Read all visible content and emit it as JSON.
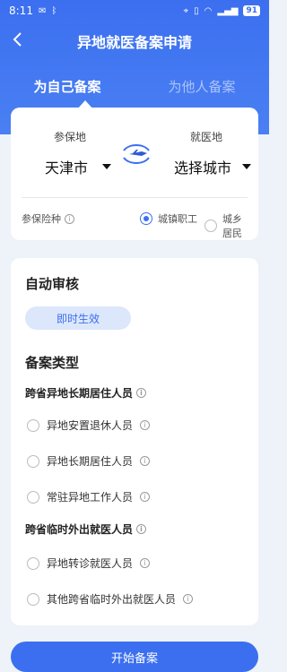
{
  "status": {
    "time": "8:11",
    "battery": "91"
  },
  "header": {
    "title": "异地就医备案申请"
  },
  "tabs": [
    {
      "label": "为自己备案",
      "active": true
    },
    {
      "label": "为他人备案",
      "active": false
    }
  ],
  "location": {
    "insured_label": "参保地",
    "insured_value": "天津市",
    "medical_label": "就医地",
    "medical_value": "选择城市"
  },
  "insurance": {
    "label": "参保险种",
    "options": [
      {
        "label": "城镇职工",
        "selected": true
      },
      {
        "label": "城乡居民",
        "selected": false
      }
    ]
  },
  "audit": {
    "title": "自动审核",
    "badge": "即时生效"
  },
  "filing": {
    "title": "备案类型",
    "group1_title": "跨省异地长期居住人员",
    "group1_options": [
      "异地安置退休人员",
      "异地长期居住人员",
      "常驻异地工作人员"
    ],
    "group2_title": "跨省临时外出就医人员",
    "group2_options": [
      "异地转诊就医人员",
      "其他跨省临时外出就医人员"
    ]
  },
  "cta": {
    "label": "开始备案"
  },
  "colors": {
    "primary": "#3b6ff0",
    "badge_bg": "#dde7fb",
    "page_bg": "#eef2f9"
  },
  "icons": [
    "back-arrow-icon",
    "swap-icon",
    "info-icon",
    "caret-down-icon",
    "wifi-icon",
    "signal-icon"
  ]
}
